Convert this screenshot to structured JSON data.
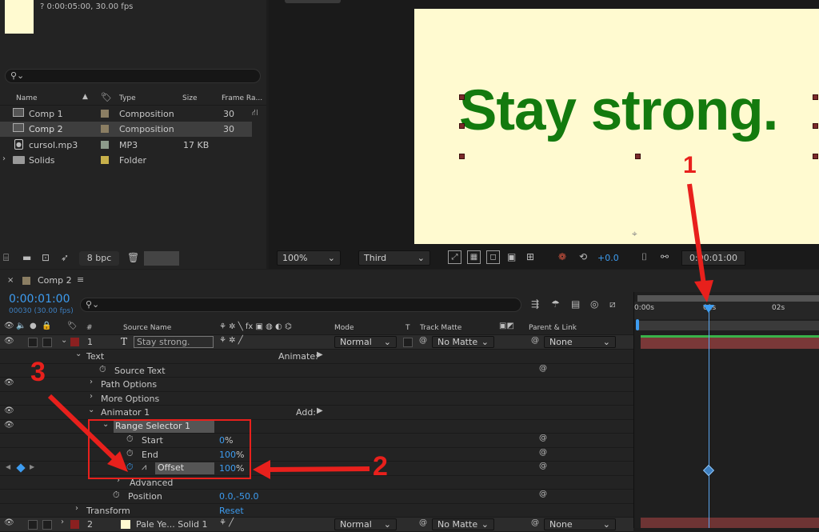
{
  "project": {
    "footage_info": "? 0:00:05:00, 30.00 fps",
    "columns": {
      "name": "Name",
      "type": "Type",
      "size": "Size",
      "frame_rate": "Frame Ra..."
    },
    "items": [
      {
        "name": "Comp 1",
        "type": "Composition",
        "size": "",
        "fps": "30",
        "label_color": "#8b7e63"
      },
      {
        "name": "Comp 2",
        "type": "Composition",
        "size": "",
        "fps": "30",
        "label_color": "#8b7e63"
      },
      {
        "name": "cursol.mp3",
        "type": "MP3",
        "size": "17 KB",
        "fps": "",
        "label_color": "#8c9a8a"
      },
      {
        "name": "Solids",
        "type": "Folder",
        "size": "",
        "fps": "",
        "label_color": "#c7b04a"
      }
    ],
    "bpc": "8 bpc"
  },
  "viewer": {
    "text": "Stay strong.",
    "text_color": "#137a0e",
    "bg_color": "#fffad0",
    "zoom": "100%",
    "resolution": "Third",
    "exposure": "+0.0",
    "timecode": "0:00:01:00"
  },
  "timeline": {
    "comp_tab": "Comp 2",
    "timecode": "0:00:01:00",
    "frame_info": "00030 (30.00 fps)",
    "ruler": [
      "0:00s",
      "01s",
      "02s"
    ],
    "headers": {
      "source_name": "Source Name",
      "mode": "Mode",
      "t": "T",
      "track_matte": "Track Matte",
      "parent": "Parent & Link",
      "hash": "#"
    },
    "layer1": {
      "num": "1",
      "name": "Stay strong.",
      "mode": "Normal",
      "matte": "No Matte",
      "parent": "None"
    },
    "props": {
      "text": "Text",
      "animate": "Animate:",
      "source_text": "Source Text",
      "path_options": "Path Options",
      "more_options": "More Options",
      "animator": "Animator 1",
      "add": "Add:",
      "range_selector": "Range Selector 1",
      "start": "Start",
      "start_val": "0",
      "end": "End",
      "end_val": "100",
      "offset": "Offset",
      "offset_val": "100",
      "pct": "%",
      "advanced": "Advanced",
      "position": "Position",
      "position_val": "0.0,-50.0",
      "transform": "Transform",
      "reset": "Reset"
    },
    "layer2": {
      "num": "2",
      "name": "Pale Ye... Solid 1",
      "mode": "Normal",
      "matte": "No Matte",
      "parent": "None"
    }
  },
  "annotations": {
    "n1": "1",
    "n2": "2",
    "n3": "3",
    "arrow_color": "#e8201c"
  }
}
